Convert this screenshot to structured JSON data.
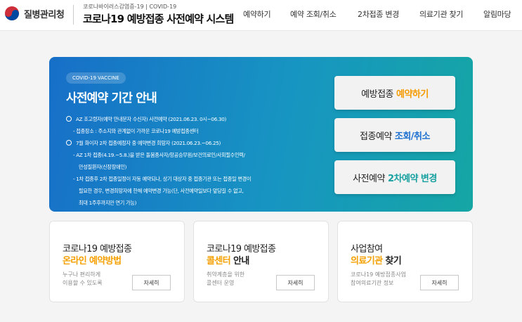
{
  "header": {
    "logo_text": "질병관리청",
    "site_subtitle": "코로나바이러스감염증-19 | COVID-19",
    "site_title": "코로나19 예방접종 사전예약 시스템",
    "nav": [
      "예약하기",
      "예약 조회/취소",
      "2차접종 변경",
      "의료기관 찾기",
      "알림마당"
    ]
  },
  "hero": {
    "tag": "COVID-19 VACCINE",
    "title": "사전예약 기간 안내",
    "notices": [
      "AZ 조고령자(예약 안내문자 수신자) 사전예약 (2021.06.23. 0시~06.30)",
      "- 접종장소 : 주소지와 관계없이 가까운 코로나19 예방접종센터",
      "7월 화이자 2차 접종예정자 중 예약변경 희망자 (2021.06.23.~06.25)",
      "- AZ 1차 접종(4.19.~5.8.)을 받은 돌봄종사자/항공승무원/보건의료인/사회필수인력/",
      "만성질환자(신장장애인)",
      "- 1차 접종후 2차 접종일정이 자동 예약되나, 상기 대상자 중 접종기관 또는 접종일 변경이",
      "필요한 경우, 변경희망자에 한해 예약변경 가능(단, 사전예약일보다 앞당길 수 없고,",
      "최대 1주후까지만 연기 가능)"
    ],
    "buttons": [
      {
        "prefix": "예방접종",
        "highlight": "예약하기",
        "color": "#f59a00"
      },
      {
        "prefix": "접종예약",
        "highlight": "조회/취소",
        "color": "#1a6fd0"
      },
      {
        "prefix": "사전예약",
        "highlight": "2차예약 변경",
        "color": "#17a0a0"
      }
    ]
  },
  "cards": [
    {
      "line1": "코로나19 예방접종",
      "line2_highlight": "온라인 예약방법",
      "line2_rest": "",
      "desc1": "누구나 편리하게",
      "desc2": "이용할 수 있도록",
      "button": "자세히"
    },
    {
      "line1": "코로나19 예방접종",
      "line2_highlight": "콜센터",
      "line2_rest": " 안내",
      "desc1": "취약계층을 위한",
      "desc2": "콜센터 운영",
      "button": "자세히"
    },
    {
      "line1": "사업참여",
      "line2_highlight": "의료기관",
      "line2_rest": " 찾기",
      "desc1": "코로나19 예방접종사업",
      "desc2": "참여의료기관 정보",
      "button": "자세히"
    }
  ],
  "colors": {
    "highlight": "#f5a000"
  }
}
